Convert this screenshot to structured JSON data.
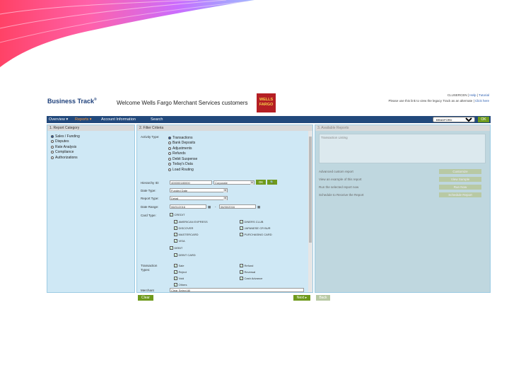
{
  "header": {
    "brand": "Business Track",
    "brand_mark": "®",
    "welcome": "Welcome Wells Fargo Merchant Services customers",
    "logo_text_line1": "WELLS",
    "logo_text_line2": "FARGO",
    "user": "CLUSERCEN",
    "help": "Help",
    "tutorial": "Tutorial",
    "user_msg": "Please use this link to view the legacy Track as an alternate",
    "click_here": "Click here"
  },
  "nav": {
    "items": [
      "Overview ▾",
      "Reports ▾",
      "Account Information",
      "Search"
    ],
    "selector_value": "BRADFORD",
    "ok": "OK"
  },
  "panel1": {
    "title": "1. Report Category",
    "options": [
      {
        "label": "Sales / Funding",
        "selected": true
      },
      {
        "label": "Disputes",
        "selected": false
      },
      {
        "label": "Rate Analysis",
        "selected": false
      },
      {
        "label": "Compliance",
        "selected": false
      },
      {
        "label": "Authorizations",
        "selected": false
      }
    ]
  },
  "panel2": {
    "title": "2. Filter Criteria",
    "activity_type_label": "Activity Type:",
    "activity_options": [
      {
        "label": "Transactions",
        "selected": true
      },
      {
        "label": "Bank Deposits",
        "selected": false
      },
      {
        "label": "Adjustments",
        "selected": false
      },
      {
        "label": "Refunds",
        "selected": false
      },
      {
        "label": "Debit Suspense",
        "selected": false
      },
      {
        "label": "Today's Data",
        "selected": false
      },
      {
        "label": "Load Routing",
        "selected": false
      }
    ],
    "hierarchy_label": "Hierarchy ID:",
    "hierarchy_value": "400000180000",
    "hierarchy_level": "Corporate",
    "ok": "OK",
    "date_type_label": "Date Type:",
    "date_type_value": "Funded Date",
    "report_type_label": "Report Type:",
    "report_type_value": "Detail",
    "date_range_label": "Date Range:",
    "date_from": "06/01/2016",
    "date_sep": "-",
    "date_to": "06/30/2016",
    "card_type_label": "Card Type:",
    "credit_label": "CREDIT",
    "credit_cards": [
      "AMERICAN EXPRESS",
      "DINERS CLUB",
      "DISCOVER",
      "JAPANESE CR BUR",
      "MASTERCARD",
      "PURCHASING CARD",
      "VISA"
    ],
    "debit_label": "DEBIT",
    "debit_card": "DEBIT CARD",
    "txn_types_label_1": "Transaction",
    "txn_types_label_2": "Types:",
    "txn_types": [
      "Sale",
      "Refund",
      "Reject",
      "Reversal",
      "Void",
      "Cash Advance",
      "Others"
    ],
    "merchant_label": "Merchant",
    "merchant_value": "Clear   Select All"
  },
  "panel3": {
    "title": "3. Available Reports",
    "box_label": "Transaction Listing",
    "rows": [
      "Advanced custom report",
      "View an example of this report",
      "Run the selected report now",
      "Schedule to Receive the Report"
    ],
    "buttons": [
      "Customize",
      "View Sample",
      "Run Now",
      "Schedule Report"
    ]
  },
  "footer": {
    "clear": "Clear",
    "next": "Next ▸",
    "back": "Back"
  },
  "colors": {
    "nav_bg": "#22497c",
    "panel_bg": "#cfe8f5",
    "accent_green": "#6f9a1c",
    "wells_red": "#b51f24"
  }
}
